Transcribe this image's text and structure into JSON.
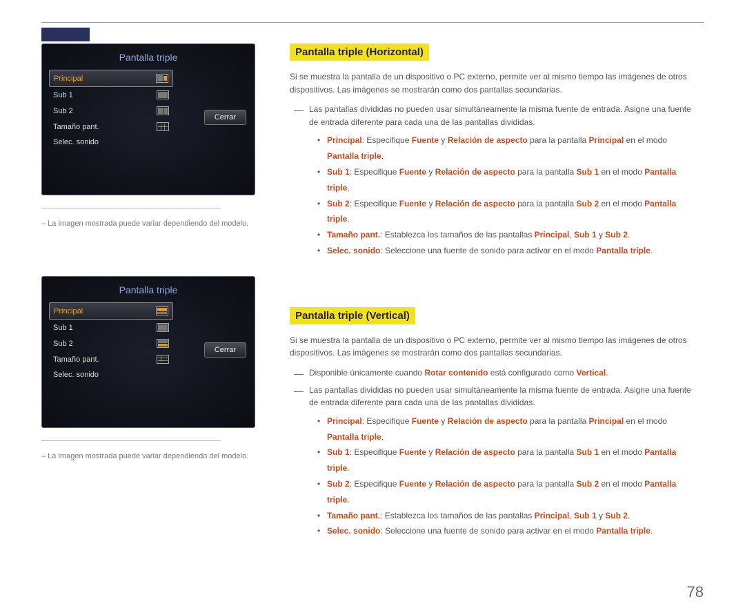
{
  "page_number": "78",
  "sections": [
    {
      "heading": "Pantalla triple (Horizontal)",
      "desc": "Si se muestra la pantalla de un dispositivo o PC externo, permite ver al mismo tiempo las imágenes de otros dispositivos. Las imágenes se mostrarán como dos pantallas secundarias.",
      "notes": [
        "Las pantallas divididas no pueden usar simultáneamente la misma fuente de entrada. Asigne una fuente de entrada diferente para cada una de las pantallas divididas."
      ],
      "bullets": [
        {
          "lead": "Principal",
          "t1": ": Especifique ",
          "k1": "Fuente",
          "t2": " y ",
          "k2": "Relación de aspecto",
          "t3": " para la pantalla ",
          "k3": "Principal",
          "t4": " en el modo ",
          "k4": "Pantalla triple",
          "t5": "."
        },
        {
          "lead": "Sub 1",
          "t1": ": Especifique ",
          "k1": "Fuente",
          "t2": " y ",
          "k2": "Relación de aspecto",
          "t3": " para la pantalla ",
          "k3": "Sub 1",
          "t4": " en el modo ",
          "k4": "Pantalla triple",
          "t5": "."
        },
        {
          "lead": "Sub 2",
          "t1": ": Especifique ",
          "k1": "Fuente",
          "t2": " y ",
          "k2": "Relación de aspecto",
          "t3": " para la pantalla ",
          "k3": "Sub 2",
          "t4": " en el modo ",
          "k4": "Pantalla triple",
          "t5": "."
        },
        {
          "lead": "Tamaño pant.",
          "t1": ": Establezca los tamaños de las pantallas ",
          "k1": "Principal",
          "t2": ", ",
          "k2": "Sub 1",
          "t3": " y ",
          "k3": "Sub 2",
          "t4": ".",
          "k4": "",
          "t5": ""
        },
        {
          "lead": "Selec. sonido",
          "t1": ": Seleccione una fuente de sonido para activar en el modo ",
          "k1": "Pantalla triple",
          "t2": ".",
          "k2": "",
          "t3": "",
          "k3": "",
          "t4": "",
          "k4": "",
          "t5": ""
        }
      ],
      "osd": {
        "title": "Pantalla triple",
        "items": [
          "Principal",
          "Sub 1",
          "Sub 2",
          "Tamaño pant.",
          "Selec. sonido"
        ],
        "close": "Cerrar"
      },
      "caption": "La imagen mostrada puede variar dependiendo del modelo."
    },
    {
      "heading": "Pantalla triple (Vertical)",
      "desc": "Si se muestra la pantalla de un dispositivo o PC externo, permite ver al mismo tiempo las imágenes de otros dispositivos. Las imágenes se mostrarán como dos pantallas secundarias.",
      "notes": [
        "Disponible únicamente cuando Rotar contenido está configurado como Vertical.",
        "Las pantallas divididas no pueden usar simultáneamente la misma fuente de entrada. Asigne una fuente de entrada diferente para cada una de las pantallas divididas."
      ],
      "note1_pre": "Disponible únicamente cuando ",
      "note1_k1": "Rotar contenido",
      "note1_mid": " está configurado como ",
      "note1_k2": "Vertical",
      "note1_post": ".",
      "bullets": [
        {
          "lead": "Principal",
          "t1": ": Especifique ",
          "k1": "Fuente",
          "t2": " y ",
          "k2": "Relación de aspecto",
          "t3": " para la pantalla ",
          "k3": "Principal",
          "t4": " en el modo ",
          "k4": "Pantalla triple",
          "t5": "."
        },
        {
          "lead": "Sub 1",
          "t1": ": Especifique ",
          "k1": "Fuente",
          "t2": " y ",
          "k2": "Relación de aspecto",
          "t3": " para la pantalla ",
          "k3": "Sub 1",
          "t4": " en el modo ",
          "k4": "Pantalla triple",
          "t5": "."
        },
        {
          "lead": "Sub 2",
          "t1": ": Especifique ",
          "k1": "Fuente",
          "t2": " y ",
          "k2": "Relación de aspecto",
          "t3": " para la pantalla ",
          "k3": "Sub 2",
          "t4": " en el modo ",
          "k4": "Pantalla triple",
          "t5": "."
        },
        {
          "lead": "Tamaño pant.",
          "t1": ": Establezca los tamaños de las pantallas ",
          "k1": "Principal",
          "t2": ", ",
          "k2": "Sub 1",
          "t3": " y ",
          "k3": "Sub 2",
          "t4": ".",
          "k4": "",
          "t5": ""
        },
        {
          "lead": "Selec. sonido",
          "t1": ": Seleccione una fuente de sonido para activar en el modo ",
          "k1": "Pantalla triple",
          "t2": ".",
          "k2": "",
          "t3": "",
          "k3": "",
          "t4": "",
          "k4": "",
          "t5": ""
        }
      ],
      "osd": {
        "title": "Pantalla triple",
        "items": [
          "Principal",
          "Sub 1",
          "Sub 2",
          "Tamaño pant.",
          "Selec. sonido"
        ],
        "close": "Cerrar"
      },
      "caption": "La imagen mostrada puede variar dependiendo del modelo."
    }
  ]
}
